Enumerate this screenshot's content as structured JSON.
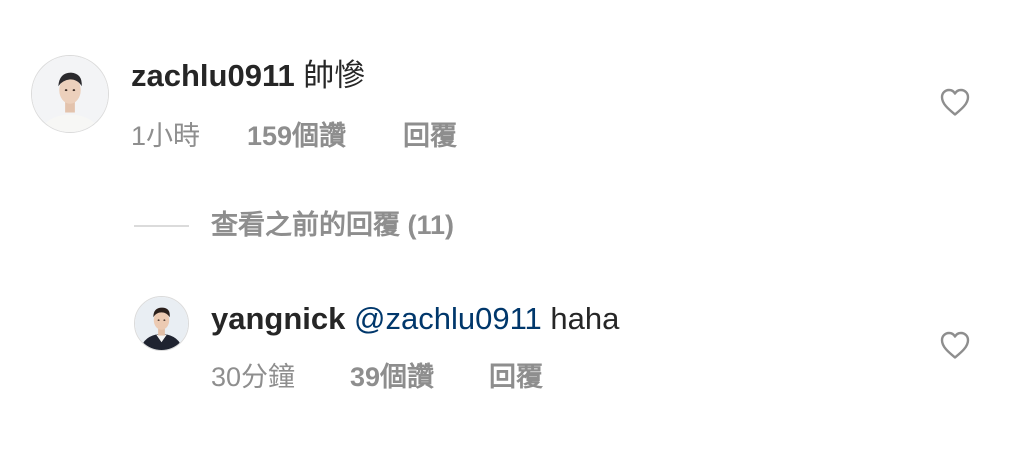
{
  "comments": [
    {
      "username": "zachlu0911",
      "text": "帥慘",
      "time": "1小時",
      "likes": "159個讚",
      "reply_label": "回覆",
      "avatar_icon": "profile-photo-icon",
      "like_icon": "heart-outline-icon"
    }
  ],
  "view_replies": {
    "label": "查看之前的回覆 (11)"
  },
  "replies": [
    {
      "username": "yangnick",
      "mention": "@zachlu0911",
      "text": "haha",
      "time": "30分鐘",
      "likes": "39個讚",
      "reply_label": "回覆",
      "avatar_icon": "profile-photo-icon",
      "like_icon": "heart-outline-icon"
    }
  ],
  "colors": {
    "text_primary": "#262626",
    "text_secondary": "#8e8e8e",
    "mention": "#00376b",
    "divider": "#dbdbdb"
  }
}
